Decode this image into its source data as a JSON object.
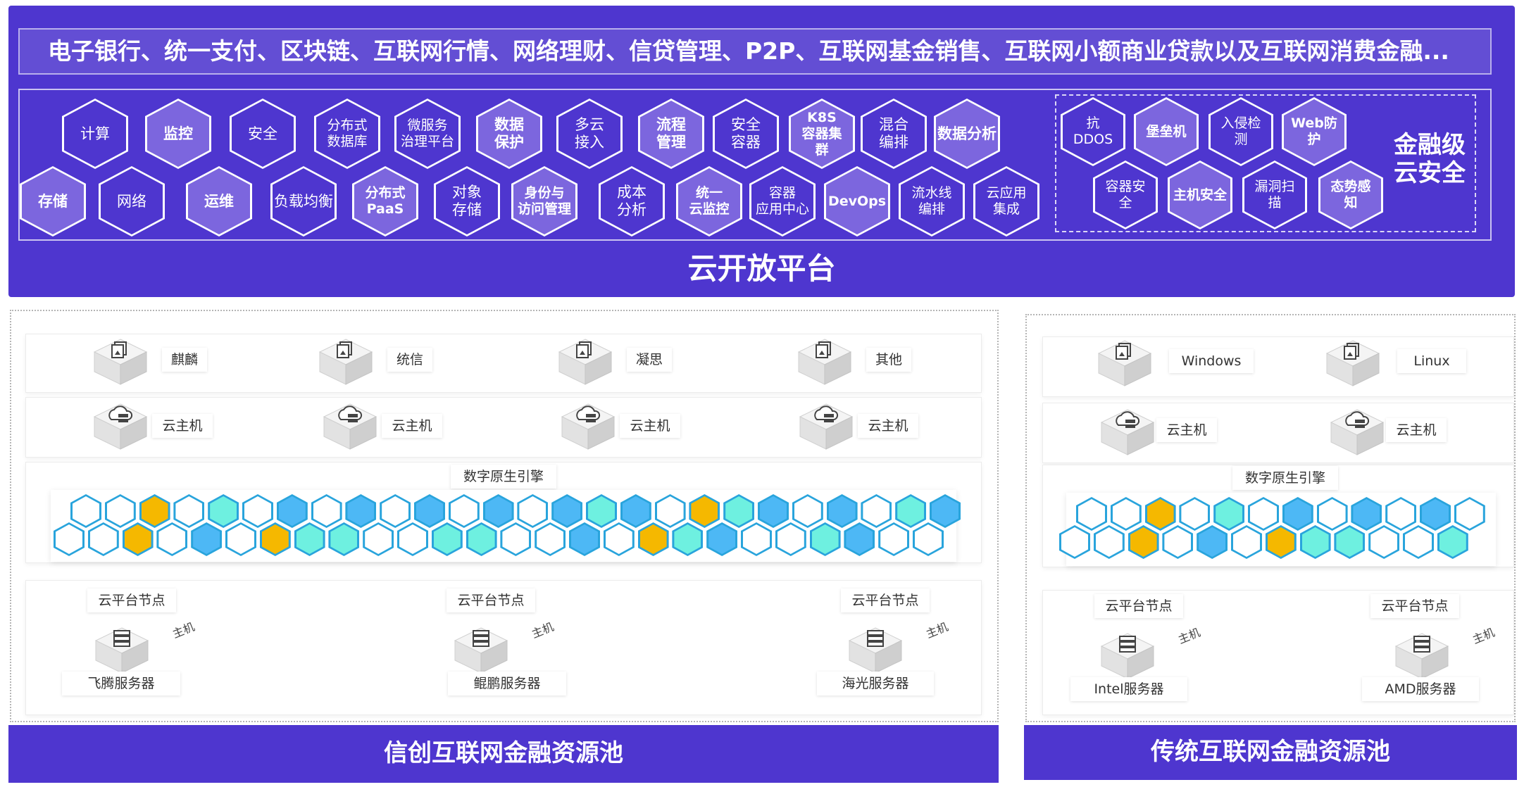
{
  "banner": "电子银行、统一支付、区块链、互联网行情、网络理财、信贷管理、P2P、互联网基金销售、互联网小额商业贷款以及互联网消费金融...",
  "platform_title": "云开放平台",
  "security_title": "金融级\n云安全",
  "services_row1": [
    "计算",
    "监控",
    "安全",
    "分布式\n数据库",
    "微服务\n治理平台",
    "数据\n保护",
    "多云\n接入",
    "流程\n管理",
    "安全\n容器",
    "K8S\n容器集\n群",
    "混合\n编排",
    "数据分析"
  ],
  "services_row2": [
    "存储",
    "网络",
    "运维",
    "负载均衡",
    "分布式\nPaaS",
    "对象\n存储",
    "身份与\n访问管理",
    "成本\n分析",
    "统一\n云监控",
    "容器\n应用中心",
    "DevOps",
    "流水线\n编排",
    "云应用\n集成"
  ],
  "security_row1": [
    "抗\nDDOS",
    "堡垒机",
    "入侵检\n测",
    "Web防\n护"
  ],
  "security_row2": [
    "容器安\n全",
    "主机安全",
    "漏洞扫\n描",
    "态势感\n知"
  ],
  "left_pool": {
    "os": [
      "麒麟",
      "统信",
      "凝思",
      "其他"
    ],
    "vm": [
      "云主机",
      "云主机",
      "云主机",
      "云主机"
    ],
    "engine": "数字原生引擎",
    "node_label": "云平台节点",
    "host_label": "主机",
    "servers": [
      "飞腾服务器",
      "鲲鹏服务器",
      "海光服务器"
    ],
    "footer": "信创互联网金融资源池"
  },
  "right_pool": {
    "os": [
      "Windows",
      "Linux"
    ],
    "vm": [
      "云主机",
      "云主机"
    ],
    "engine": "数字原生引擎",
    "node_label": "云平台节点",
    "host_label": "主机",
    "servers": [
      "Intel服务器",
      "AMD服务器"
    ],
    "footer": "传统互联网金融资源池"
  },
  "colors": {
    "brand": "#4e36cf",
    "hex_light": "#7c66de",
    "engine_blue": "#4db8f5",
    "engine_cyan": "#6ef0e0",
    "engine_gold": "#f5b800",
    "engine_white": "#ffffff"
  }
}
